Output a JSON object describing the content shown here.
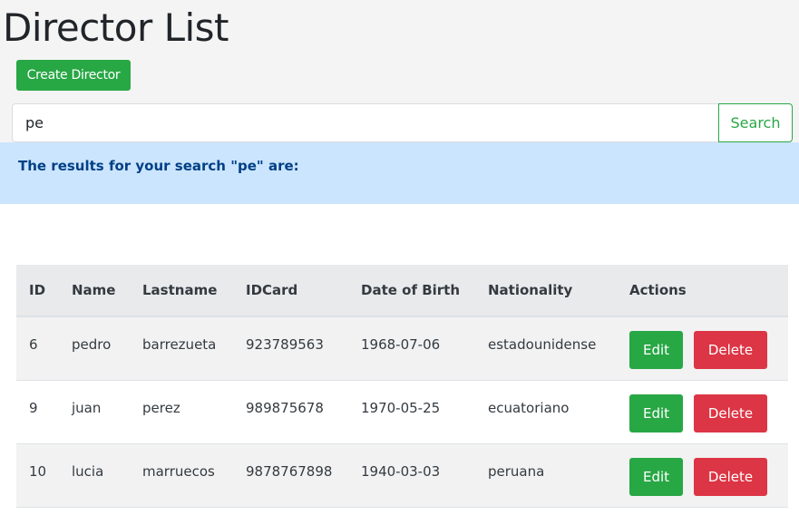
{
  "page": {
    "title": "Director List"
  },
  "toolbar": {
    "create_label": "Create Director"
  },
  "search": {
    "value": "pe",
    "button_label": "Search"
  },
  "alert": {
    "message": "The results for your search \"pe\" are:"
  },
  "table": {
    "headers": [
      "ID",
      "Name",
      "Lastname",
      "IDCard",
      "Date of Birth",
      "Nationality",
      "Actions"
    ],
    "rows": [
      {
        "id": "6",
        "name": "pedro",
        "lastname": "barrezueta",
        "idcard": "923789563",
        "dob": "1968-07-06",
        "nationality": "estadounidense"
      },
      {
        "id": "9",
        "name": "juan",
        "lastname": "perez",
        "idcard": "989875678",
        "dob": "1970-05-25",
        "nationality": "ecuatoriano"
      },
      {
        "id": "10",
        "name": "lucia",
        "lastname": "marruecos",
        "idcard": "9878767898",
        "dob": "1940-03-03",
        "nationality": "peruana"
      }
    ],
    "edit_label": "Edit",
    "delete_label": "Delete"
  },
  "colors": {
    "success": "#28a745",
    "danger": "#dc3545",
    "alert_bg": "#cce5ff",
    "alert_text": "#004085",
    "header_bg": "#e8eaec"
  }
}
